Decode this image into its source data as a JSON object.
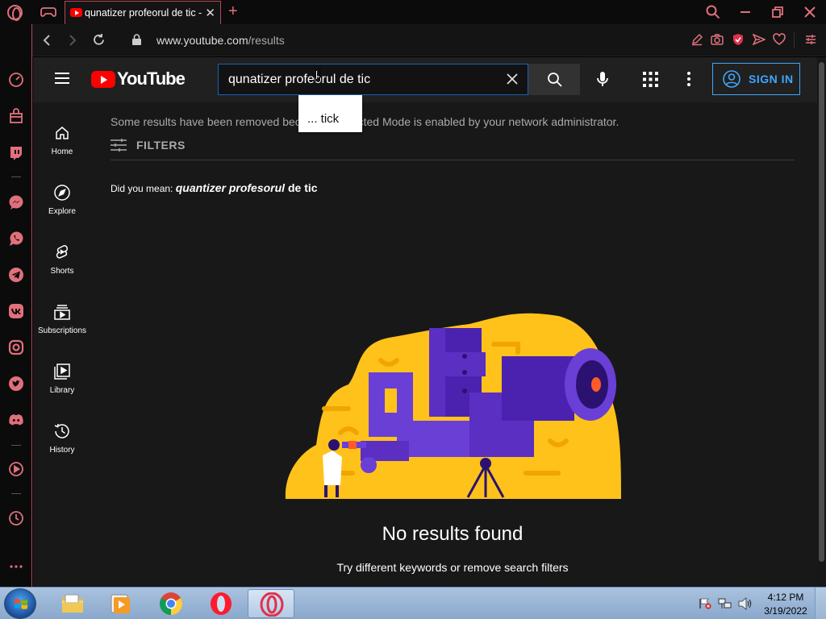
{
  "browser": {
    "tab_title": "qunatizer profeorul de tic - YouTube",
    "new_tab_symbol": "+",
    "url_domain": "www.youtube.com",
    "url_path": "/results",
    "accent_color": "#e0707b"
  },
  "youtube": {
    "logo_text": "YouTube",
    "search": {
      "value": "qunatizer profeorul de tic",
      "placeholder": "Search"
    },
    "signin_label": "SIGN IN",
    "guide": [
      {
        "label": "Home",
        "icon": "home-icon"
      },
      {
        "label": "Explore",
        "icon": "compass-icon"
      },
      {
        "label": "Shorts",
        "icon": "shorts-icon"
      },
      {
        "label": "Subscriptions",
        "icon": "subscriptions-icon"
      },
      {
        "label": "Library",
        "icon": "library-icon"
      },
      {
        "label": "History",
        "icon": "history-icon"
      }
    ],
    "notice": "Some results have been removed because Restricted Mode is enabled by your network administrator.",
    "filters_label": "FILTERS",
    "did_you_mean_prefix": "Did you mean: ",
    "suggestion_italic": "quantizer profesorul",
    "suggestion_rest": " de tic",
    "no_results_title": "No results found",
    "no_results_hint": "Try different keywords or remove search filters",
    "autocomplete_text": "... tick",
    "link_color": "#3ea6ff"
  },
  "taskbar": {
    "apps": [
      {
        "name": "file-explorer",
        "active": false
      },
      {
        "name": "media-player",
        "active": false
      },
      {
        "name": "chrome",
        "active": false
      },
      {
        "name": "opera",
        "active": false
      },
      {
        "name": "opera-gx",
        "active": true
      }
    ],
    "clock_time": "4:12 PM",
    "clock_date": "3/19/2022"
  }
}
